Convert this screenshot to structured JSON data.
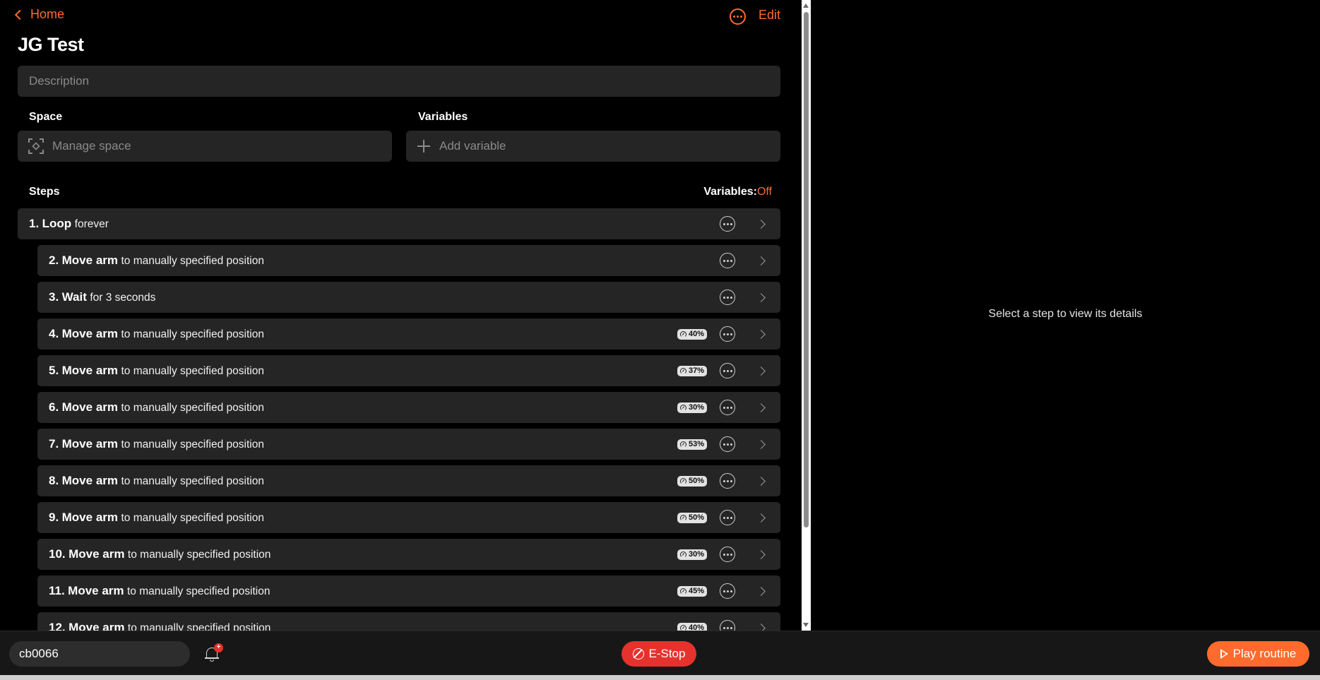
{
  "header": {
    "back_label": "Home",
    "edit_label": "Edit",
    "title": "JG Test"
  },
  "description": {
    "placeholder": "Description"
  },
  "space": {
    "label": "Space",
    "button_label": "Manage space"
  },
  "variables": {
    "label": "Variables",
    "button_label": "Add variable"
  },
  "steps_section": {
    "label": "Steps",
    "variables_toggle_label": "Variables:",
    "variables_toggle_value": "Off"
  },
  "steps": [
    {
      "num": "1.",
      "action": "Loop",
      "detail": "forever",
      "speed": null,
      "indent": 0
    },
    {
      "num": "2.",
      "action": "Move arm",
      "detail": "to manually specified position",
      "speed": null,
      "indent": 1
    },
    {
      "num": "3.",
      "action": "Wait",
      "detail": "for 3 seconds",
      "speed": null,
      "indent": 1
    },
    {
      "num": "4.",
      "action": "Move arm",
      "detail": "to manually specified position",
      "speed": "40%",
      "indent": 1
    },
    {
      "num": "5.",
      "action": "Move arm",
      "detail": "to manually specified position",
      "speed": "37%",
      "indent": 1
    },
    {
      "num": "6.",
      "action": "Move arm",
      "detail": "to manually specified position",
      "speed": "30%",
      "indent": 1
    },
    {
      "num": "7.",
      "action": "Move arm",
      "detail": "to manually specified position",
      "speed": "53%",
      "indent": 1
    },
    {
      "num": "8.",
      "action": "Move arm",
      "detail": "to manually specified position",
      "speed": "50%",
      "indent": 1
    },
    {
      "num": "9.",
      "action": "Move arm",
      "detail": "to manually specified position",
      "speed": "50%",
      "indent": 1
    },
    {
      "num": "10.",
      "action": "Move arm",
      "detail": "to manually specified position",
      "speed": "30%",
      "indent": 1
    },
    {
      "num": "11.",
      "action": "Move arm",
      "detail": "to manually specified position",
      "speed": "45%",
      "indent": 1
    },
    {
      "num": "12.",
      "action": "Move arm",
      "detail": "to manually specified position",
      "speed": "40%",
      "indent": 1
    }
  ],
  "detail_panel": {
    "hint": "Select a step to view its details"
  },
  "bottom_bar": {
    "device_name": "cb0066",
    "notification_badge": "+",
    "estop_label": "E-Stop",
    "play_label": "Play routine"
  },
  "colors": {
    "accent": "#ff6b2c",
    "danger": "#e5322d",
    "row_bg": "#252525",
    "background": "#000000"
  }
}
